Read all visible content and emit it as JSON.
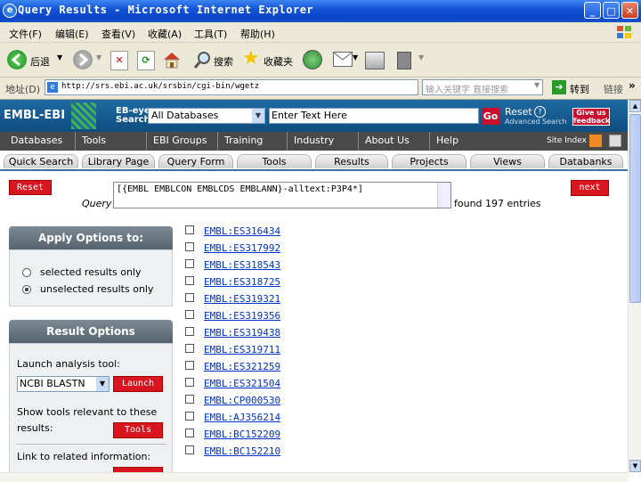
{
  "window": {
    "title": "Query Results - Microsoft Internet Explorer"
  },
  "menu": [
    "文件(F)",
    "编辑(E)",
    "查看(V)",
    "收藏(A)",
    "工具(T)",
    "帮助(H)"
  ],
  "toolbar": {
    "back": "后退",
    "search": "搜索",
    "favorites": "收藏夹"
  },
  "address": {
    "label": "地址(D)",
    "url": "http://srs.ebi.ac.uk/srsbin/cgi-bin/wgetz",
    "search_placeholder": "输入关键字 直接搜索",
    "go": "转到",
    "links": "链接"
  },
  "ebi": {
    "logo": "EMBL-EBI",
    "eb_eye_line1": "EB-eye",
    "eb_eye_line2": "Search",
    "db_select": "All Databases",
    "text_placeholder": "Enter Text Here",
    "go": "Go",
    "reset": "Reset",
    "advanced": "Advanced Search",
    "feedback": "Give us feedback"
  },
  "nav": [
    "Databases",
    "Tools",
    "EBI Groups",
    "Training",
    "Industry",
    "About Us",
    "Help"
  ],
  "site_index": "Site Index",
  "tabs": [
    "Quick Search",
    "Library Page",
    "Query Form",
    "Tools",
    "Results",
    "Projects",
    "Views",
    "Databanks"
  ],
  "query": {
    "reset": "Reset",
    "label": "Query",
    "text": "[{EMBL EMBLCON EMBLCDS EMBLANN}-alltext:P3P4*]",
    "found": "found 197 entries",
    "next": "next"
  },
  "apply_options": {
    "title": "Apply Options to:",
    "selected": "selected results only",
    "unselected": "unselected results only"
  },
  "result_options": {
    "title": "Result Options",
    "launch_label": "Launch analysis tool:",
    "tool_select": "NCBI BLASTN",
    "launch_btn": "Launch",
    "show_tools": "Show tools relevant to these results:",
    "tools_btn": "Tools",
    "link_related": "Link to related information:"
  },
  "results": [
    "EMBL:ES316434",
    "EMBL:ES317992",
    "EMBL:ES318543",
    "EMBL:ES318725",
    "EMBL:ES319321",
    "EMBL:ES319356",
    "EMBL:ES319438",
    "EMBL:ES319711",
    "EMBL:ES321259",
    "EMBL:ES321504",
    "EMBL:CP000530",
    "EMBL:AJ356214",
    "EMBL:BC152209",
    "EMBL:BC152210"
  ],
  "colors": {
    "ie_blue": "#0a46c8",
    "ebi_blue": "#1f6aa0",
    "red": "#d9161f",
    "link": "#0033cc"
  }
}
